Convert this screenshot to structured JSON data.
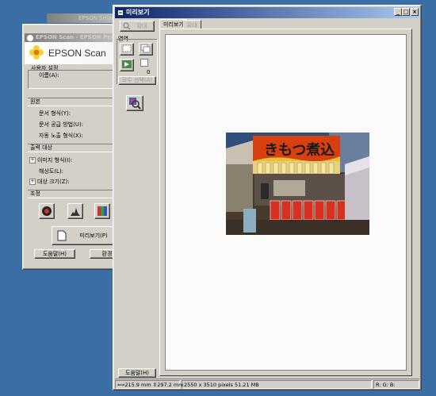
{
  "scan_window": {
    "behind_title": "EPSON Smart Pa",
    "title": "EPSON Scan - EPSON Perfe",
    "logo_text": "EPSON Scan",
    "settings_label": "사용자 설정",
    "name_label": "이름(A):",
    "original_section": "원본",
    "doc_type_label": "문서 형식(Y):",
    "doc_source_label": "문서 공급 방법(U):",
    "auto_exposure_label": "자동 노출 형식(X):",
    "output_section": "출력 대상",
    "image_type_label": "이미지 형식(I):",
    "resolution_label": "해상도(L):",
    "target_size_label": "대상 크기(Z):",
    "adjust_section": "조정",
    "preview_button": "미리보기(P)",
    "help_button": "도움말(H)",
    "config_button": "환경"
  },
  "preview_window": {
    "title": "미리보기",
    "zoom_button": "확대",
    "area_label": "영역",
    "count_value": "0",
    "select_all_button": "모두 선택(A)",
    "tab_preview": "미리보기",
    "tab_zoom": "확대",
    "help_button": "도움말(H)",
    "status_size": "215.9 mm",
    "status_height": "297.2 mm",
    "status_pixels": "2550 x 3510 pixels 51.21 MB",
    "status_rgb": "R:  G:  B:"
  },
  "photo": {
    "banner_text": "きもつ煮込"
  },
  "colors": {
    "desktop": "#3a6ea5",
    "active_title": "#0a246a",
    "panel": "#d4d0c8"
  }
}
